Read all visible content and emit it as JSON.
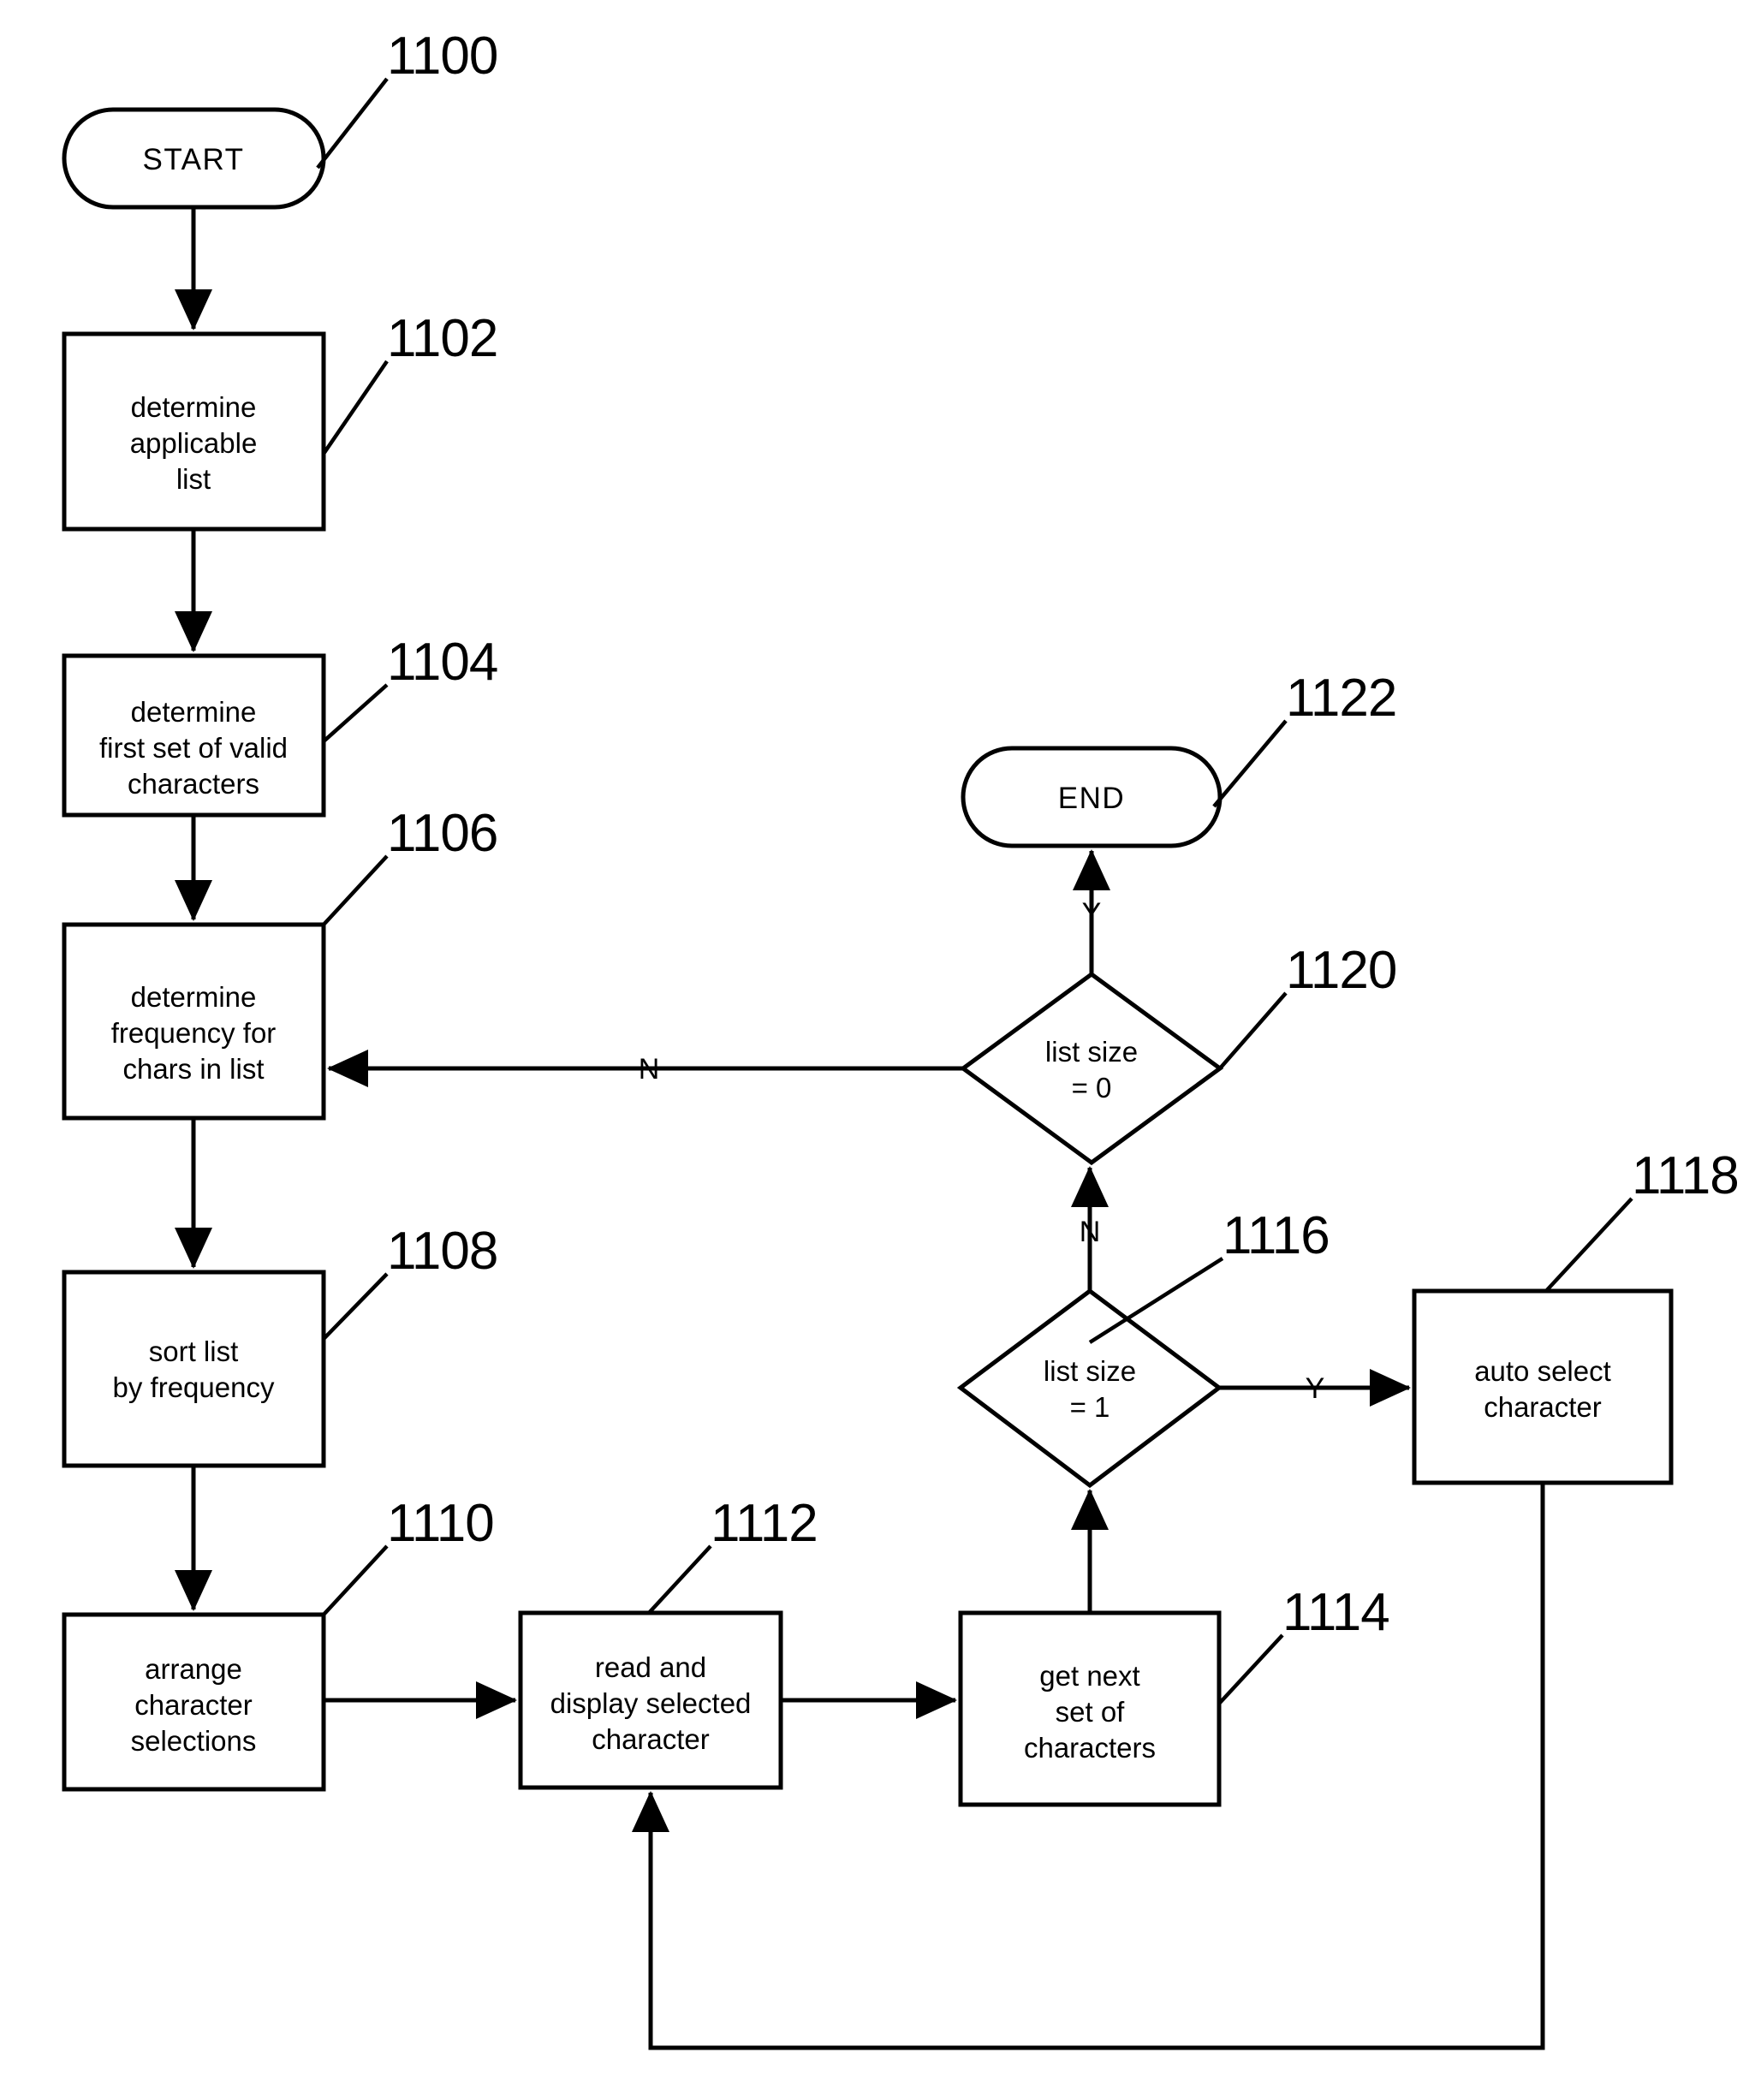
{
  "diagram": {
    "title": "",
    "type": "flowchart",
    "stroke_color": "#000000",
    "fill_color": "#ffffff",
    "nodes": [
      {
        "id": "start",
        "ref": "1100",
        "shape": "terminator",
        "lines": [
          "START"
        ]
      },
      {
        "id": "n1102",
        "ref": "1102",
        "shape": "process",
        "lines": [
          "determine",
          "applicable",
          "list"
        ]
      },
      {
        "id": "n1104",
        "ref": "1104",
        "shape": "process",
        "lines": [
          "determine",
          "first set of valid",
          "characters"
        ]
      },
      {
        "id": "n1106",
        "ref": "1106",
        "shape": "process",
        "lines": [
          "determine",
          "frequency for",
          "chars in list"
        ]
      },
      {
        "id": "n1108",
        "ref": "1108",
        "shape": "process",
        "lines": [
          "sort list",
          "by frequency"
        ]
      },
      {
        "id": "n1110",
        "ref": "1110",
        "shape": "process",
        "lines": [
          "arrange",
          "character",
          "selections"
        ]
      },
      {
        "id": "n1112",
        "ref": "1112",
        "shape": "process",
        "lines": [
          "read and",
          "display selected",
          "character"
        ]
      },
      {
        "id": "n1114",
        "ref": "1114",
        "shape": "process",
        "lines": [
          "get next",
          "set of",
          "characters"
        ]
      },
      {
        "id": "n1116",
        "ref": "1116",
        "shape": "decision",
        "lines": [
          "list size",
          "= 1"
        ]
      },
      {
        "id": "n1118",
        "ref": "1118",
        "shape": "process",
        "lines": [
          "auto select",
          "character"
        ]
      },
      {
        "id": "n1120",
        "ref": "1120",
        "shape": "decision",
        "lines": [
          "list size",
          "= 0"
        ]
      },
      {
        "id": "end",
        "ref": "1122",
        "shape": "terminator",
        "lines": [
          "END"
        ]
      }
    ],
    "edges": [
      {
        "from": "start",
        "to": "n1102",
        "label": ""
      },
      {
        "from": "n1102",
        "to": "n1104",
        "label": ""
      },
      {
        "from": "n1104",
        "to": "n1106",
        "label": ""
      },
      {
        "from": "n1106",
        "to": "n1108",
        "label": ""
      },
      {
        "from": "n1108",
        "to": "n1110",
        "label": ""
      },
      {
        "from": "n1110",
        "to": "n1112",
        "label": ""
      },
      {
        "from": "n1112",
        "to": "n1114",
        "label": ""
      },
      {
        "from": "n1114",
        "to": "n1116",
        "label": ""
      },
      {
        "from": "n1116",
        "to": "n1118",
        "label": "Y"
      },
      {
        "from": "n1116",
        "to": "n1120",
        "label": "N"
      },
      {
        "from": "n1120",
        "to": "end",
        "label": "Y"
      },
      {
        "from": "n1120",
        "to": "n1106",
        "label": "N"
      },
      {
        "from": "n1118",
        "to": "n1112",
        "label": ""
      }
    ],
    "edge_labels": {
      "yes": "Y",
      "no": "N"
    },
    "reference_numerals": [
      "1100",
      "1102",
      "1104",
      "1106",
      "1108",
      "1110",
      "1112",
      "1114",
      "1116",
      "1118",
      "1120",
      "1122"
    ]
  }
}
